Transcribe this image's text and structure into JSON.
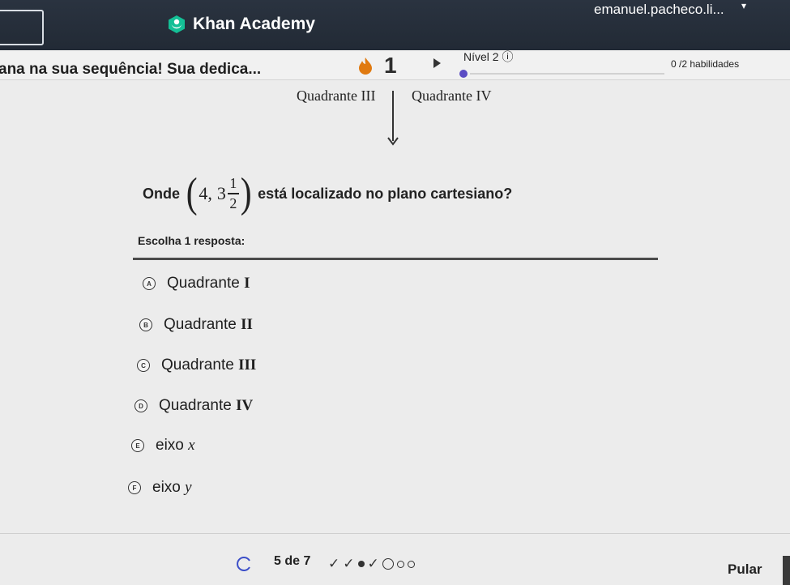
{
  "header": {
    "brand": "Khan Academy",
    "user": "emanuel.pacheco.li...",
    "icons": [
      "search-box",
      "khan-leaf-logo",
      "chevron-down-icon"
    ]
  },
  "mission": {
    "title": "ana na sua sequência! Sua dedica...",
    "streak": "1",
    "level": "Nível 2 ⓘ",
    "skills": "0 /2 habilidades",
    "colors": {
      "flame": "#e07a10",
      "level_dot": "#5b4cc4"
    }
  },
  "graph_fragment": {
    "left_label": "Quadrante III",
    "right_label": "Quadrante IV"
  },
  "question": {
    "prefix": "Onde",
    "coord_x": "4,",
    "coord_whole": "3",
    "coord_num": "1",
    "coord_den": "2",
    "suffix": "está localizado no plano cartesiano?"
  },
  "choose_label": "Escolha 1 resposta:",
  "options": [
    {
      "letter": "A",
      "text": "Quadrante ",
      "math": "I"
    },
    {
      "letter": "B",
      "text": "Quadrante ",
      "math": "II"
    },
    {
      "letter": "C",
      "text": "Quadrante ",
      "math": "III"
    },
    {
      "letter": "D",
      "text": "Quadrante ",
      "math": "IV"
    },
    {
      "letter": "E",
      "text": "eixo ",
      "math": "x"
    },
    {
      "letter": "F",
      "text": "eixo ",
      "math": "y"
    }
  ],
  "footer": {
    "progress": "5 de 7",
    "marks": [
      "✓",
      "✓",
      "dot",
      "✓",
      "ring-big",
      "ring",
      "ring"
    ],
    "skip": "Pular"
  }
}
